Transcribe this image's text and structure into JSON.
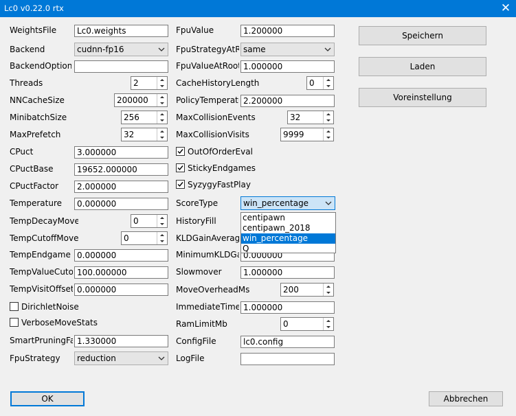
{
  "window": {
    "title": "Lc0 v0.22.0 rtx",
    "close_glyph": "✕"
  },
  "left": {
    "weightsfile": {
      "label": "WeightsFile",
      "value": "Lc0.weights"
    },
    "backend": {
      "label": "Backend",
      "value": "cudnn-fp16"
    },
    "backendoptions": {
      "label": "BackendOptions",
      "value": ""
    },
    "threads": {
      "label": "Threads",
      "value": "2"
    },
    "nncachesize": {
      "label": "NNCacheSize",
      "value": "200000"
    },
    "minibatchsize": {
      "label": "MinibatchSize",
      "value": "256"
    },
    "maxprefetch": {
      "label": "MaxPrefetch",
      "value": "32"
    },
    "cpuct": {
      "label": "CPuct",
      "value": "3.000000"
    },
    "cpuctbase": {
      "label": "CPuctBase",
      "value": "19652.000000"
    },
    "cpuctfactor": {
      "label": "CPuctFactor",
      "value": "2.000000"
    },
    "temperature": {
      "label": "Temperature",
      "value": "0.000000"
    },
    "tempdecaymoves": {
      "label": "TempDecayMoves",
      "value": "0"
    },
    "tempcutoffmove": {
      "label": "TempCutoffMove",
      "value": "0"
    },
    "tempendgame": {
      "label": "TempEndgame",
      "value": "0.000000"
    },
    "tempvaluecutoff": {
      "label": "TempValueCutoff",
      "value": "100.000000"
    },
    "tempvisitoffset": {
      "label": "TempVisitOffset",
      "value": "0.000000"
    },
    "dirichletnoise": {
      "label": "DirichletNoise",
      "checked": false
    },
    "verbosemovestats": {
      "label": "VerboseMoveStats",
      "checked": false
    },
    "smartpruningfac": {
      "label": "SmartPruningFac",
      "value": "1.330000"
    },
    "fpustrategy": {
      "label": "FpuStrategy",
      "value": "reduction"
    }
  },
  "right": {
    "fpuvalue": {
      "label": "FpuValue",
      "value": "1.200000"
    },
    "fpustrategyatroot": {
      "label": "FpuStrategyAtRoo",
      "value": "same"
    },
    "fpuvalueatroot": {
      "label": "FpuValueAtRoot",
      "value": "1.000000"
    },
    "cachehistorylength": {
      "label": "CacheHistoryLength",
      "value": "0"
    },
    "policytemperature": {
      "label": "PolicyTemperatur",
      "value": "2.200000"
    },
    "maxcollisionevents": {
      "label": "MaxCollisionEvents",
      "value": "32"
    },
    "maxcollisionvisits": {
      "label": "MaxCollisionVisits",
      "value": "9999"
    },
    "outofordereval": {
      "label": "OutOfOrderEval",
      "checked": true
    },
    "stickyendgames": {
      "label": "StickyEndgames",
      "checked": true
    },
    "syzygyfastplay": {
      "label": "SyzygyFastPlay",
      "checked": true
    },
    "scoretype": {
      "label": "ScoreType",
      "value": "win_percentage",
      "options": [
        "centipawn",
        "centipawn_2018",
        "win_percentage",
        "Q"
      ],
      "selected_index": 2
    },
    "historyfill": {
      "label": "HistoryFill"
    },
    "kldgainaverage": {
      "label": "KLDGainAverageIn"
    },
    "minimumkldgain": {
      "label": "MinimumKLDGai",
      "value": "0.000000"
    },
    "slowmover": {
      "label": "Slowmover",
      "value": "1.000000"
    },
    "moveoverheadms": {
      "label": "MoveOverheadMs",
      "value": "200"
    },
    "immediatetime": {
      "label": "ImmediateTimeU",
      "value": "1.000000"
    },
    "ramlimitmb": {
      "label": "RamLimitMb",
      "value": "0"
    },
    "configfile": {
      "label": "ConfigFile",
      "value": "lc0.config"
    },
    "logfile": {
      "label": "LogFile",
      "value": ""
    }
  },
  "actions": {
    "save": "Speichern",
    "load": "Laden",
    "preset": "Voreinstellung"
  },
  "footer": {
    "ok": "OK",
    "cancel": "Abbrechen"
  },
  "colors": {
    "accent": "#0078d7",
    "background": "#f0f0f0"
  }
}
